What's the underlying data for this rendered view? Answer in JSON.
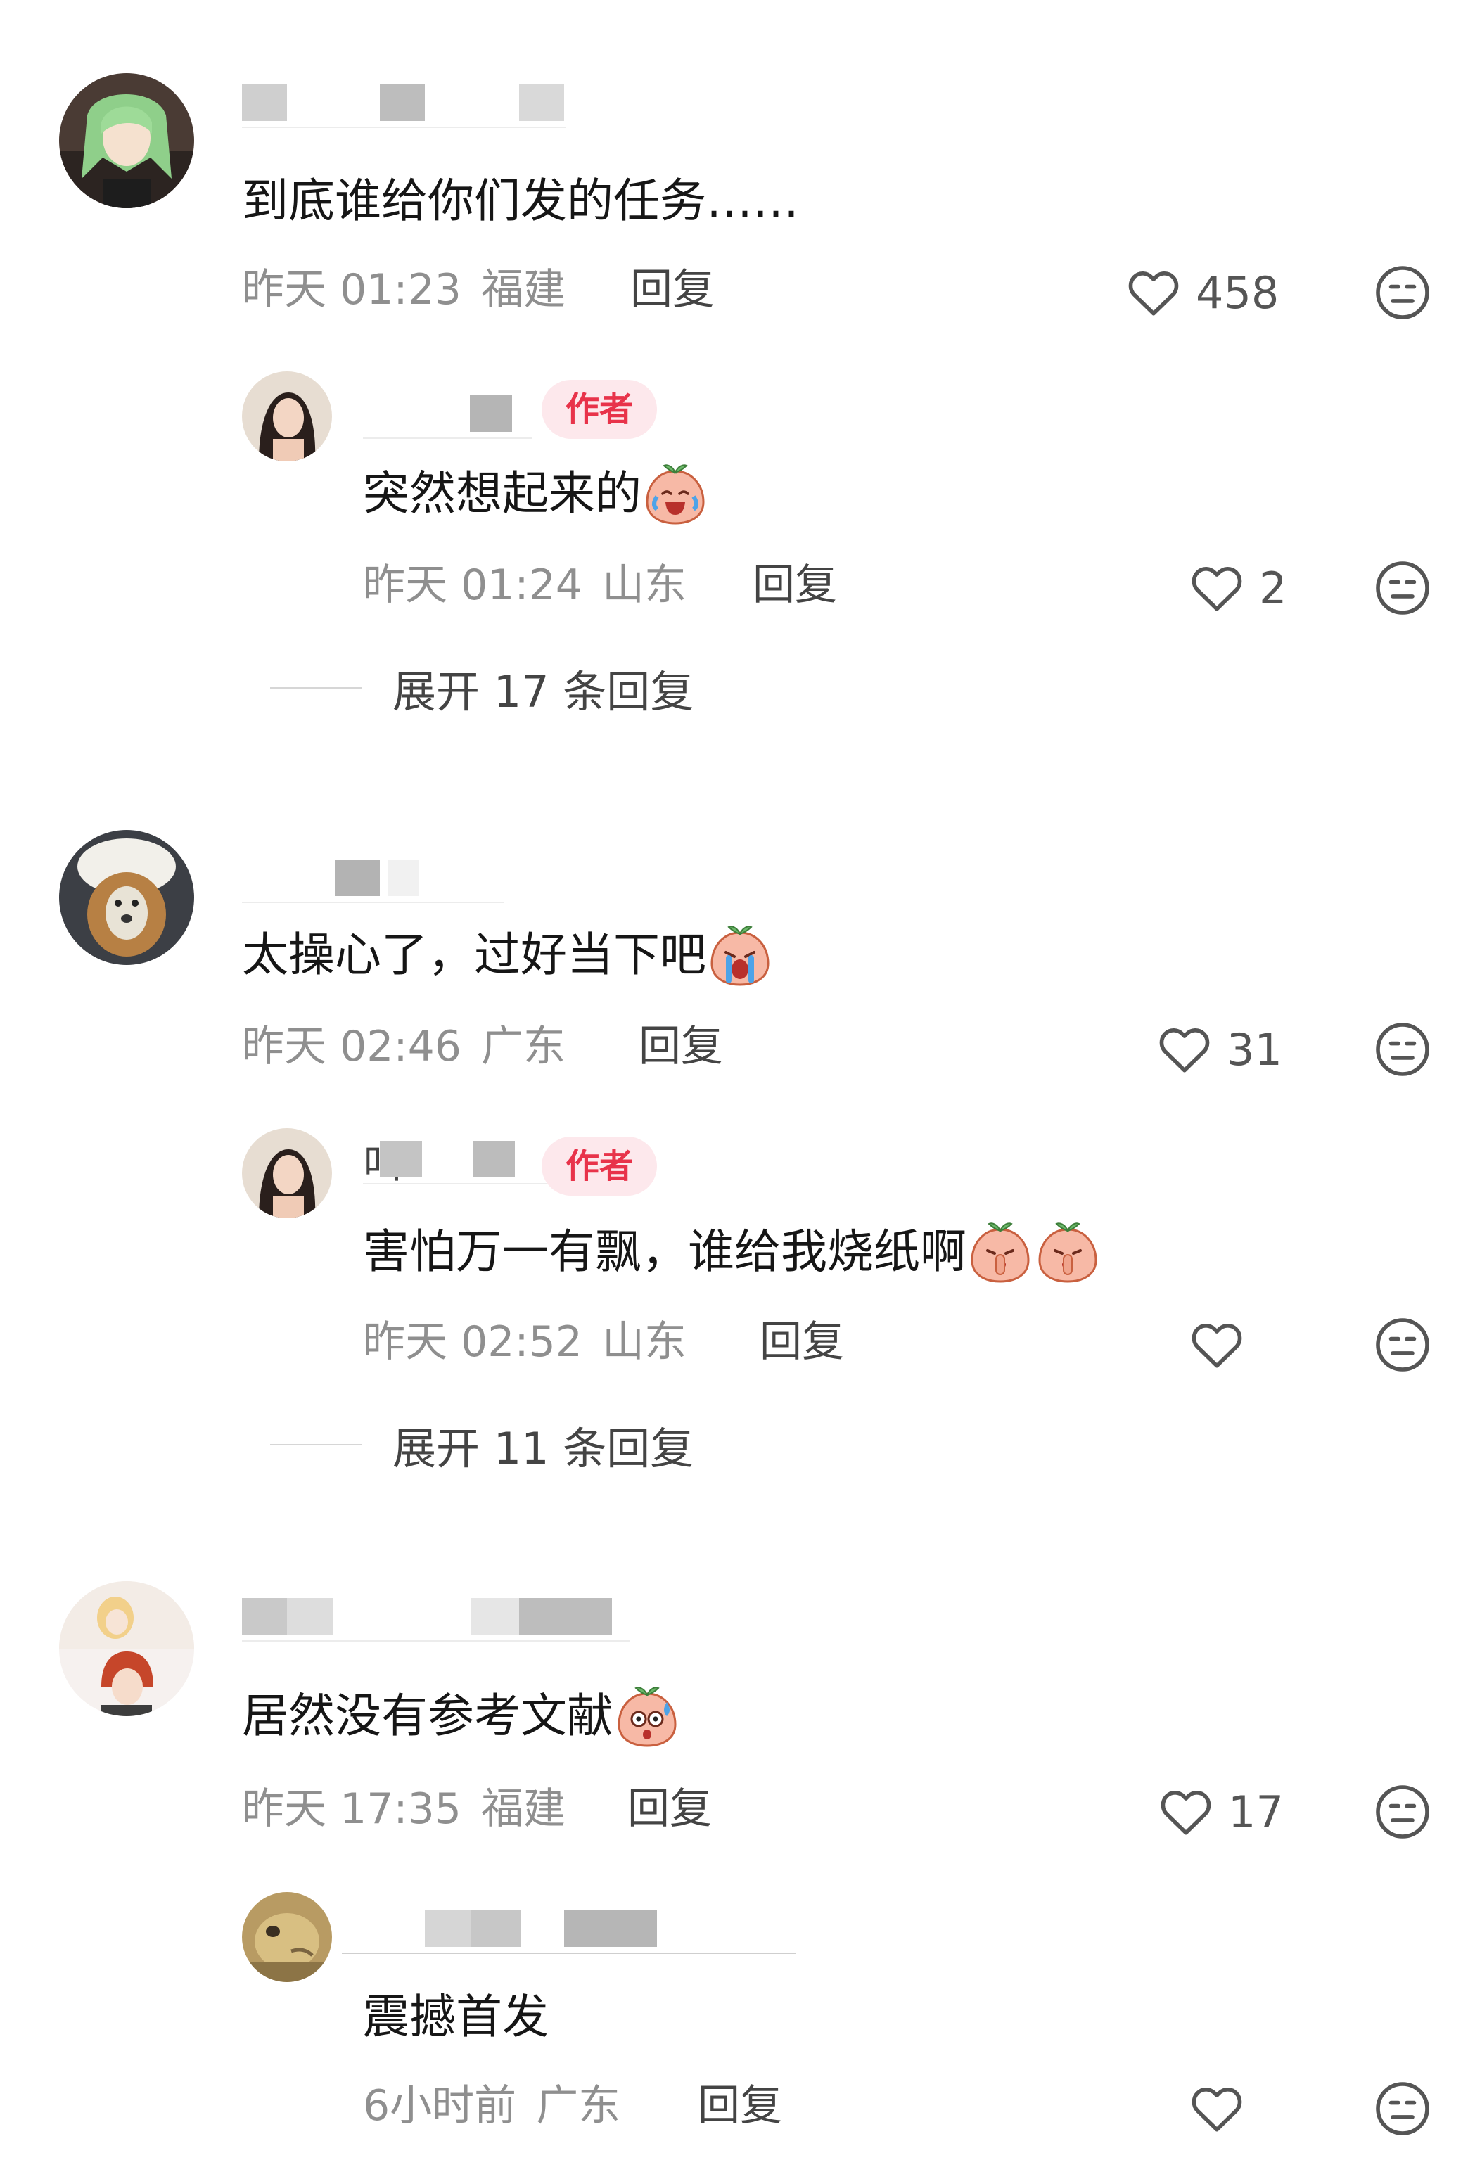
{
  "comments": [
    {
      "text": "到底谁给你们发的任务……",
      "time": "昨天 01:23",
      "location": "福建",
      "reply_label": "回复",
      "likes": "458",
      "reply": {
        "author_tag": "作者",
        "text": "突然想起来的",
        "time": "昨天 01:24",
        "location": "山东",
        "reply_label": "回复",
        "likes": "2"
      },
      "expand_label": "展开 17 条回复"
    },
    {
      "text": "太操心了，过好当下吧",
      "time": "昨天 02:46",
      "location": "广东",
      "reply_label": "回复",
      "likes": "31",
      "reply": {
        "author_tag": "作者",
        "name_fragment": "叫",
        "text": "害怕万一有飘，谁给我烧纸啊",
        "time": "昨天 02:52",
        "location": "山东",
        "reply_label": "回复",
        "likes": ""
      },
      "expand_label": "展开 11 条回复"
    },
    {
      "text": "居然没有参考文献",
      "time": "昨天 17:35",
      "location": "福建",
      "reply_label": "回复",
      "likes": "17",
      "reply": {
        "text": "震撼首发",
        "time": "6小时前",
        "location": "广东",
        "reply_label": "回复",
        "likes": ""
      }
    }
  ],
  "icons": {
    "like": "heart-outline-icon",
    "dislike": "neutral-face-icon",
    "emoji_laugh_cry": "laugh-cry-emoji",
    "emoji_sob": "sob-emoji",
    "emoji_shush": "shush-emoji",
    "emoji_shock": "shock-emoji"
  },
  "colors": {
    "author_tag_bg": "#fde8ec",
    "author_tag_text": "#e8334a",
    "meta_text": "#8f8f8f"
  }
}
